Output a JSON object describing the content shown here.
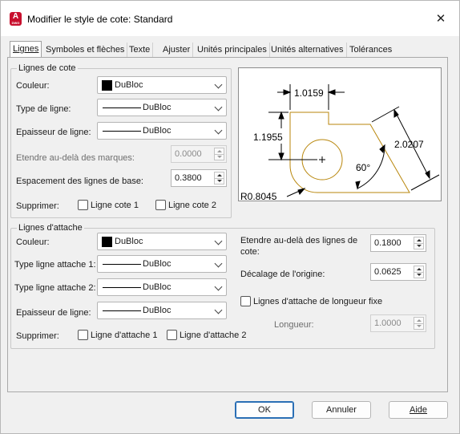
{
  "window": {
    "title": "Modifier le style de cote: Standard",
    "icon": "autocad-icon",
    "icon_letter": "A",
    "icon_sub": "DWG"
  },
  "tabs": [
    {
      "label": "Lignes",
      "active": true
    },
    {
      "label": "Symboles et flèches"
    },
    {
      "label": "Texte"
    },
    {
      "label": "Ajuster"
    },
    {
      "label": "Unités principales"
    },
    {
      "label": "Unités alternatives"
    },
    {
      "label": "Tolérances"
    }
  ],
  "lignes_cote": {
    "title": "Lignes de cote",
    "couleur": {
      "label": "Couleur:",
      "value": "DuBloc"
    },
    "type_ligne": {
      "label": "Type de ligne:",
      "value": "DuBloc"
    },
    "epaisseur": {
      "label": "Epaisseur de ligne:",
      "value": "DuBloc"
    },
    "etendre": {
      "label": "Etendre au-delà des marques:",
      "value": "0.0000"
    },
    "espacement": {
      "label": "Espacement des lignes de base:",
      "value": "0.3800"
    },
    "supprimer": {
      "label": "Supprimer:",
      "cb1": "Ligne cote 1",
      "cb2": "Ligne cote 2"
    }
  },
  "lignes_attache": {
    "title": "Lignes d'attache",
    "couleur": {
      "label": "Couleur:",
      "value": "DuBloc"
    },
    "type1": {
      "label": "Type ligne attache 1:",
      "value": "DuBloc"
    },
    "type2": {
      "label": "Type ligne attache 2:",
      "value": "DuBloc"
    },
    "epaisseur": {
      "label": "Epaisseur de ligne:",
      "value": "DuBloc"
    },
    "supprimer": {
      "label": "Supprimer:",
      "cb1": "Ligne d'attache 1",
      "cb2": "Ligne d'attache 2"
    },
    "etendre": {
      "label": "Etendre au-delà des lignes de cote:",
      "value": "0.1800"
    },
    "decalage": {
      "label": "Décalage de l'origine:",
      "value": "0.0625"
    },
    "longueur_fixe": {
      "label": "Lignes d'attache de longueur fixe"
    },
    "longueur": {
      "label": "Longueur:",
      "value": "1.0000"
    }
  },
  "preview": {
    "dim_top": "1.0159",
    "dim_left": "1.1955",
    "dim_right": "2.0207",
    "angle": "60°",
    "radius": "R0.8045",
    "colors": {
      "geometry": "#b8860b",
      "dims": "#000000"
    }
  },
  "buttons": {
    "ok": "OK",
    "cancel": "Annuler",
    "help": "Aide"
  }
}
